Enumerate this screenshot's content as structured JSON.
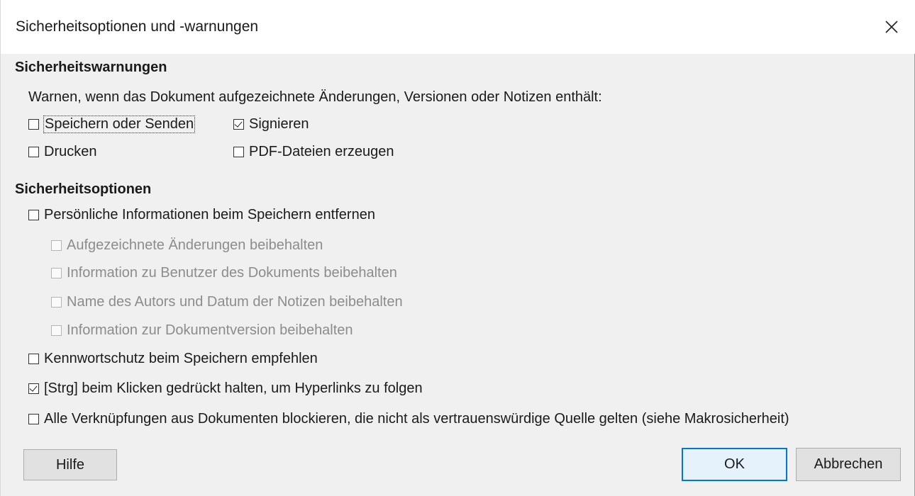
{
  "window": {
    "title": "Sicherheitsoptionen und -warnungen"
  },
  "warnings": {
    "heading": "Sicherheitswarnungen",
    "description": "Warnen, wenn das Dokument aufgezeichnete Änderungen, Versionen oder Notizen enthält:",
    "save_send": {
      "label": "Speichern oder Senden",
      "checked": false
    },
    "sign": {
      "label": "Signieren",
      "checked": true
    },
    "print": {
      "label": "Drucken",
      "checked": false
    },
    "pdf": {
      "label": "PDF-Dateien erzeugen",
      "checked": false
    }
  },
  "options": {
    "heading": "Sicherheitsoptionen",
    "remove_personal": {
      "label": "Persönliche Informationen beim Speichern entfernen",
      "checked": false
    },
    "keep_changes": {
      "label": "Aufgezeichnete Änderungen beibehalten",
      "checked": false,
      "disabled": true
    },
    "keep_user_info": {
      "label": "Information zu Benutzer des Dokuments beibehalten",
      "checked": false,
      "disabled": true
    },
    "keep_author": {
      "label": "Name des Autors und Datum der Notizen beibehalten",
      "checked": false,
      "disabled": true
    },
    "keep_version": {
      "label": "Information zur Dokumentversion beibehalten",
      "checked": false,
      "disabled": true
    },
    "password": {
      "label": "Kennwortschutz beim Speichern empfehlen",
      "checked": false
    },
    "ctrl_click": {
      "label": "[Strg] beim Klicken gedrückt halten, um Hyperlinks zu folgen",
      "checked": true
    },
    "block_links": {
      "label": "Alle Verknüpfungen aus Dokumenten blockieren, die nicht als vertrauenswürdige Quelle gelten (siehe Makrosicherheit)",
      "checked": false
    }
  },
  "buttons": {
    "help": "Hilfe",
    "ok": "OK",
    "cancel": "Abbrechen"
  }
}
